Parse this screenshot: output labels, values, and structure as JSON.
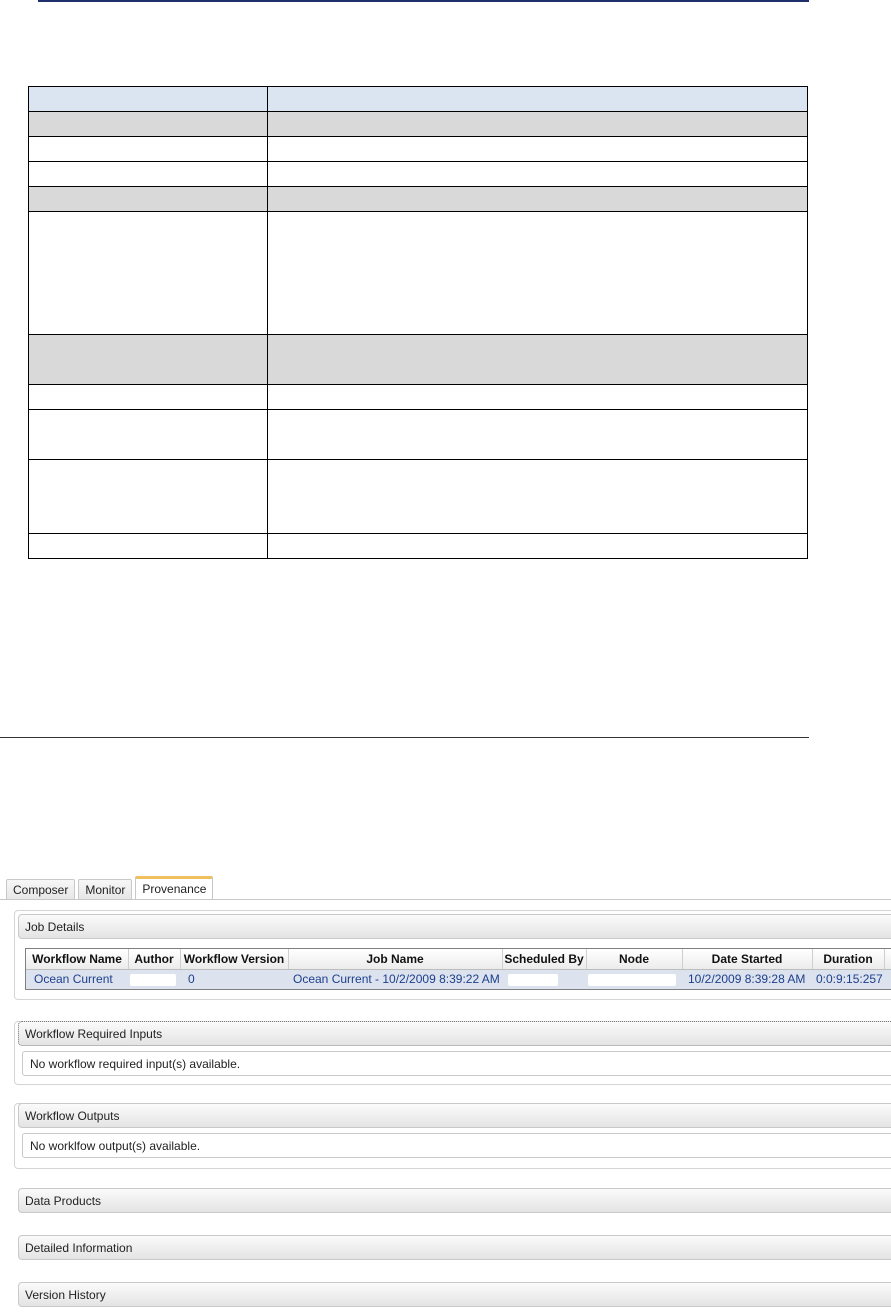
{
  "tabs": [
    "Composer",
    "Monitor",
    "Provenance"
  ],
  "active_tab": "Provenance",
  "sections": {
    "job_details": "Job Details",
    "required_inputs": "Workflow Required Inputs",
    "required_inputs_msg": "No workflow required input(s) available.",
    "outputs": "Workflow Outputs",
    "outputs_msg": "No worklfow output(s) available.",
    "data_products": "Data Products",
    "detailed_info": "Detailed Information",
    "version_history": "Version History"
  },
  "job_table": {
    "columns": [
      "Workflow Name",
      "Author",
      "Workflow Version",
      "Job Name",
      "Scheduled By",
      "Node",
      "Date Started",
      "Duration"
    ],
    "row": {
      "workflow_name": "Ocean Current",
      "author": "",
      "workflow_version": "0",
      "job_name": "Ocean Current - 10/2/2009 8:39:22 AM",
      "scheduled_by": "",
      "node": "",
      "date_started": "10/2/2009 8:39:28 AM",
      "duration": "0:0:9:15:257"
    }
  }
}
